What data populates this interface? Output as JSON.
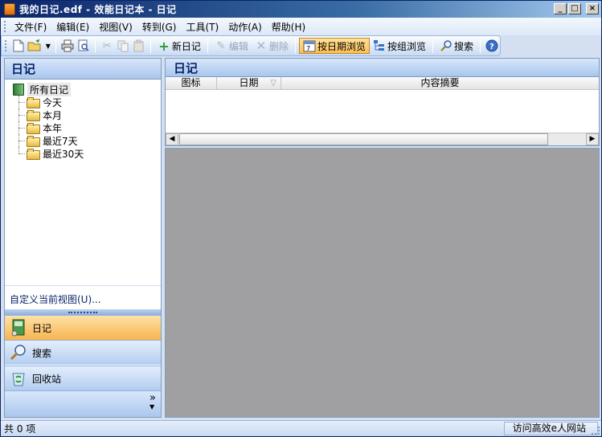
{
  "window": {
    "title": "我的日记.edf - 效能日记本 - 日记",
    "minimize": "_",
    "maximize": "□",
    "close": "×"
  },
  "menu": [
    "文件(F)",
    "编辑(E)",
    "视图(V)",
    "转到(G)",
    "工具(T)",
    "动作(A)",
    "帮助(H)"
  ],
  "toolbar": {
    "new_diary": "新日记",
    "edit": "编辑",
    "delete": "删除",
    "browse_by_date": "按日期浏览",
    "browse_by_group": "按组浏览",
    "search": "搜索"
  },
  "left_pane": {
    "header": "日记",
    "tree": {
      "root": "所有日记",
      "children": [
        "今天",
        "本月",
        "本年",
        "最近7天",
        "最近30天"
      ]
    },
    "customize_view": "自定义当前视图(U)...",
    "nav": [
      {
        "label": "日记",
        "icon": "diary-book-icon",
        "active": true
      },
      {
        "label": "搜索",
        "icon": "magnifier-icon",
        "active": false
      },
      {
        "label": "回收站",
        "icon": "recycle-bin-icon",
        "active": false
      }
    ],
    "more": "»"
  },
  "right_pane": {
    "header": "日记",
    "columns": [
      "图标",
      "日期",
      "内容摘要"
    ]
  },
  "status": {
    "count_text": "共 0 项",
    "link": "访问高效e人网站"
  },
  "colors": {
    "accent": "#f8b450",
    "title_bar": "#0a246a",
    "preview_bg": "#a09fa1"
  }
}
